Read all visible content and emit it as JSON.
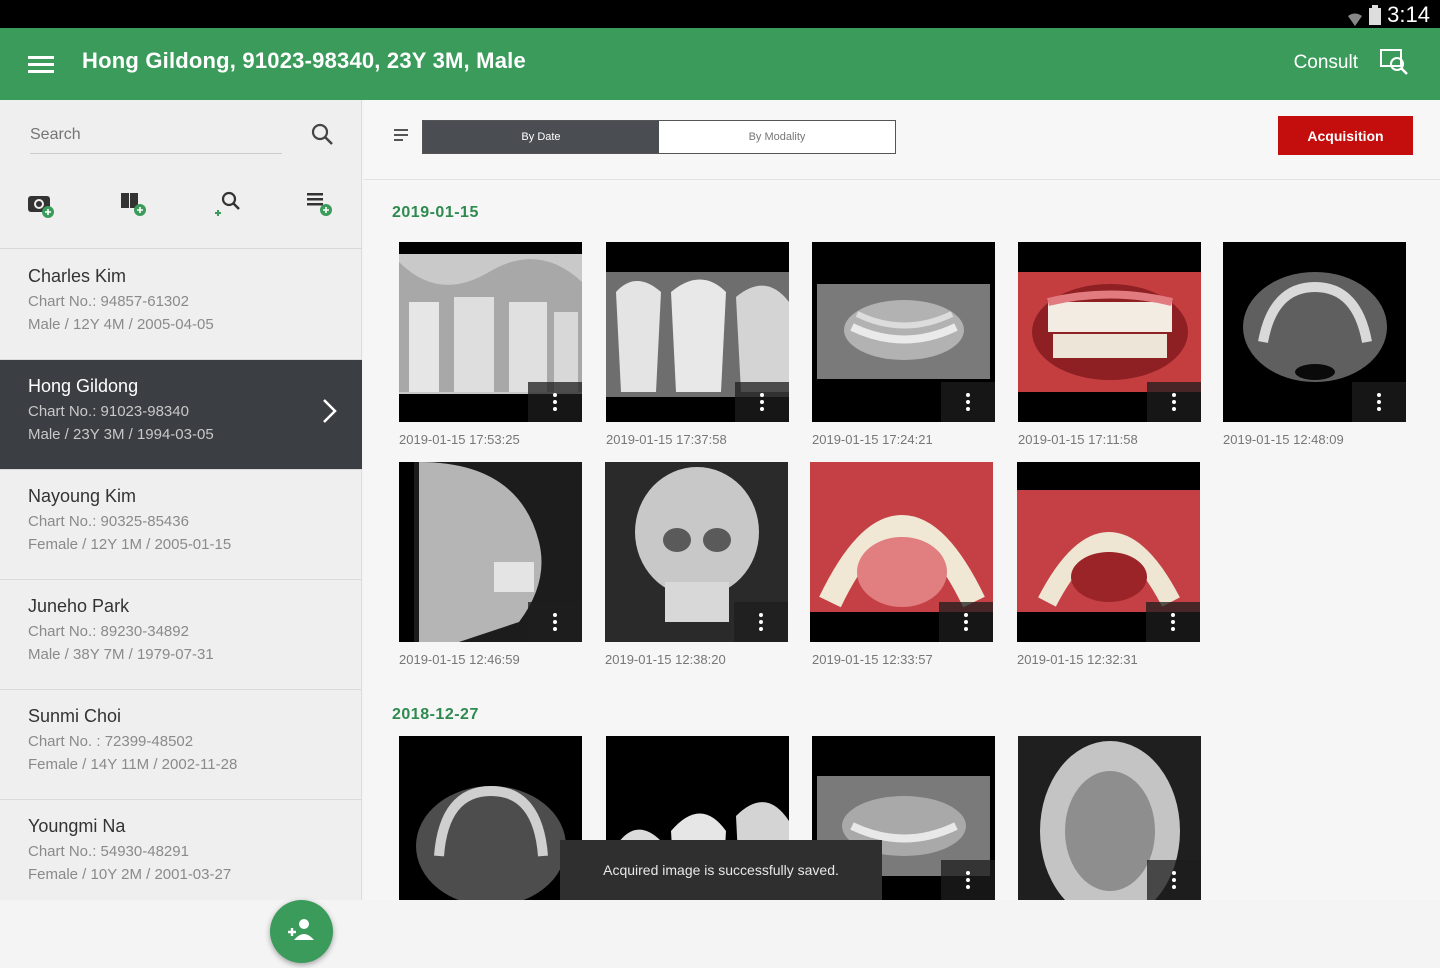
{
  "status": {
    "time": "3:14"
  },
  "appbar": {
    "title": "Hong Gildong, 91023-98340, 23Y 3M, Male",
    "consult": "Consult"
  },
  "sidebar": {
    "search_placeholder": "Search",
    "patients": [
      {
        "name": "Charles Kim",
        "chart": "Chart No.: 94857-61302",
        "info": "Male / 12Y 4M / 2005-04-05"
      },
      {
        "name": "Hong Gildong",
        "chart": "Chart No.: 91023-98340",
        "info": "Male / 23Y 3M / 1994-03-05"
      },
      {
        "name": "Nayoung Kim",
        "chart": "Chart No.: 90325-85436",
        "info": "Female / 12Y 1M / 2005-01-15"
      },
      {
        "name": "Juneho Park",
        "chart": "Chart No.: 89230-34892",
        "info": "Male / 38Y 7M / 1979-07-31"
      },
      {
        "name": "Sunmi Choi",
        "chart": "Chart No. : 72399-48502",
        "info": "Female / 14Y 11M / 2002-11-28"
      },
      {
        "name": "Youngmi Na",
        "chart": "Chart No.: 54930-48291",
        "info": "Female / 10Y 2M / 2001-03-27"
      }
    ]
  },
  "toolbar": {
    "by_date": "By Date",
    "by_modality": "By Modality",
    "acquisition": "Acquisition"
  },
  "groups": [
    {
      "date": "2019-01-15",
      "timestamps": [
        "2019-01-15 17:53:25",
        "2019-01-15 17:37:58",
        "2019-01-15 17:24:21",
        "2019-01-15 17:11:58",
        "2019-01-15 12:48:09",
        "2019-01-15 12:46:59",
        "2019-01-15 12:38:20",
        "2019-01-15 12:33:57",
        "2019-01-15 12:32:31"
      ]
    },
    {
      "date": "2018-12-27"
    }
  ],
  "toast": "Acquired image is successfully saved."
}
